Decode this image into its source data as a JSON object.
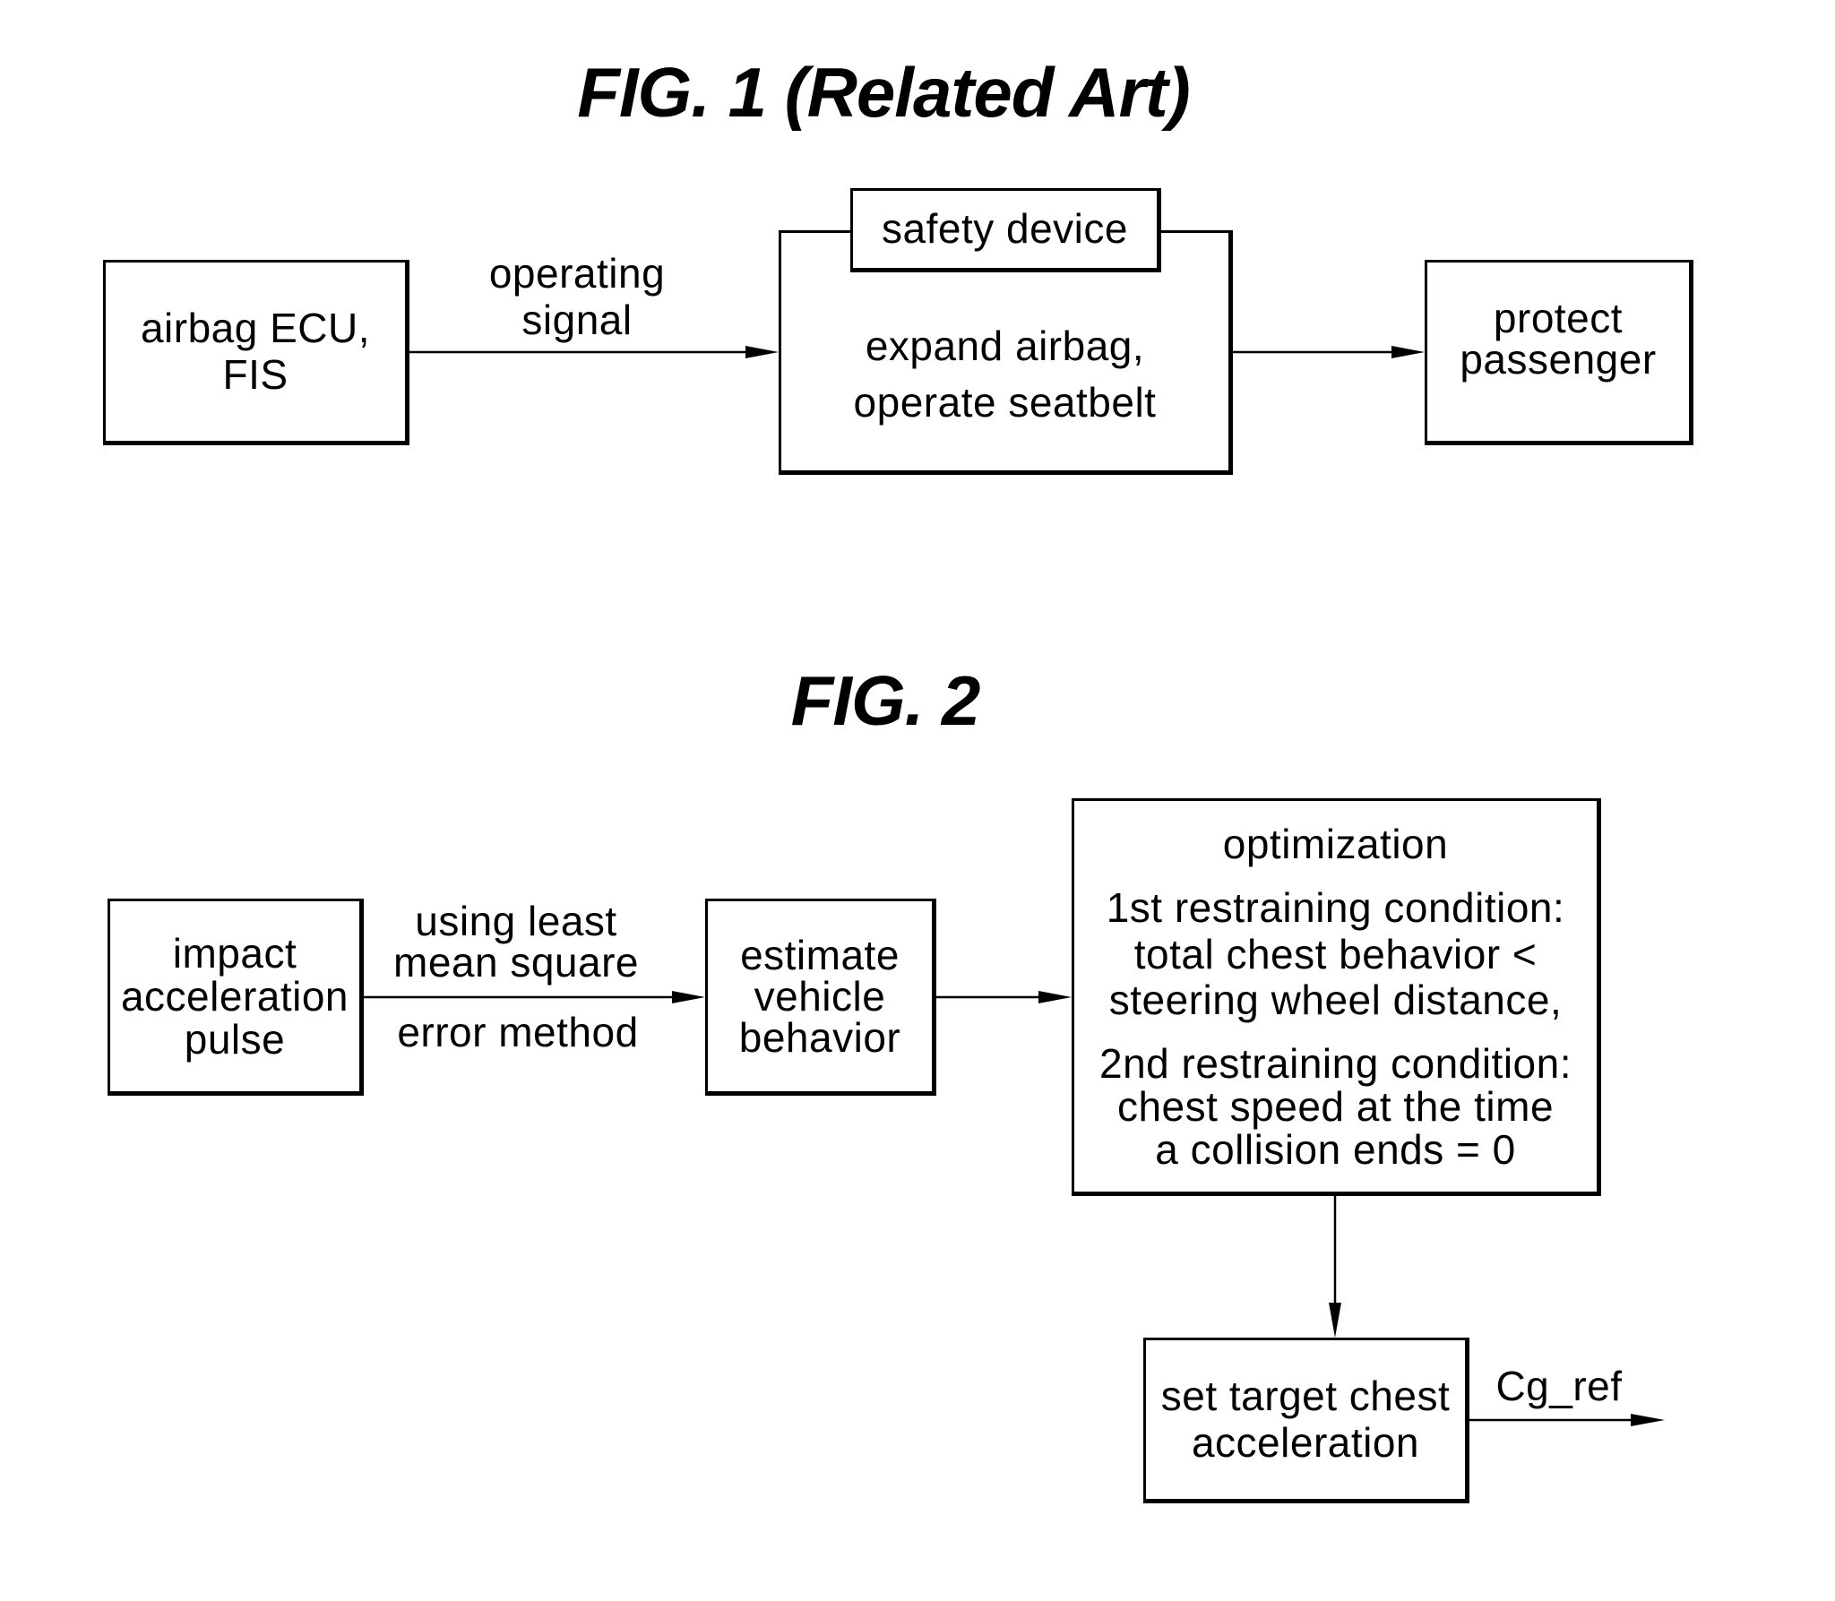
{
  "fig1": {
    "title": "FIG. 1 (Related Art)",
    "blocks": {
      "airbag_ecu": [
        "airbag ECU,",
        "FIS"
      ],
      "safety_device_label": "safety device",
      "safety_device_body": [
        "expand airbag,",
        "operate seatbelt"
      ],
      "protect": [
        "protect",
        "passenger"
      ]
    },
    "edges": {
      "operating_signal": [
        "operating",
        "signal"
      ]
    }
  },
  "fig2": {
    "title": "FIG. 2",
    "blocks": {
      "impact": [
        "impact",
        "acceleration",
        "pulse"
      ],
      "estimate": [
        "estimate",
        "vehicle",
        "behavior"
      ],
      "optimization": {
        "heading": "optimization",
        "cond1": [
          "1st restraining condition:",
          "total chest behavior <",
          "steering wheel distance,"
        ],
        "cond2": [
          "2nd restraining condition:",
          "chest speed at the time",
          "a collision ends = 0"
        ]
      },
      "set_target": [
        "set target chest",
        "acceleration"
      ]
    },
    "edges": {
      "lms_above": [
        "using least",
        "mean square"
      ],
      "lms_below": "error method",
      "output": "Cg_ref"
    }
  }
}
